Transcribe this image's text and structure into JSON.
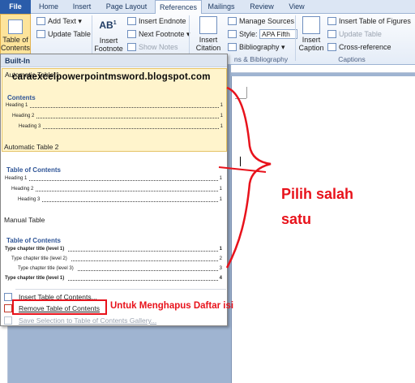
{
  "tabs": [
    "File",
    "Home",
    "Insert",
    "Page Layout",
    "References",
    "Mailings",
    "Review",
    "View"
  ],
  "active_tab": "References",
  "ribbon": {
    "toc_button": "Table of Contents",
    "add_text": "Add Text",
    "update_table": "Update Table",
    "insert_footnote": "Insert Footnote",
    "insert_endnote": "Insert Endnote",
    "next_footnote": "Next Footnote",
    "show_notes": "Show Notes",
    "insert_citation": "Insert Citation",
    "manage_sources": "Manage Sources",
    "style_label": "Style:",
    "style_value": "APA Fifth",
    "bibliography": "Bibliography",
    "group_citations": "ns & Bibliography",
    "insert_caption": "Insert Caption",
    "insert_table_of_figures": "Insert Table of Figures",
    "update_table_captions": "Update Table",
    "cross_reference": "Cross-reference",
    "group_captions": "Captions"
  },
  "menu": {
    "header": "Built-In",
    "items": [
      {
        "title": "Automatic Table 1",
        "heading": "Contents",
        "lines": [
          {
            "label": "Heading 1",
            "num": "1"
          },
          {
            "label": "Heading 2",
            "num": "1"
          },
          {
            "label": "Heading 3",
            "num": "1"
          }
        ]
      },
      {
        "title": "Automatic Table 2",
        "heading": "Table of Contents",
        "lines": [
          {
            "label": "Heading 1",
            "num": "1"
          },
          {
            "label": "Heading 2",
            "num": "1"
          },
          {
            "label": "Heading 3",
            "num": "1"
          }
        ]
      },
      {
        "title": "Manual Table",
        "heading": "Table of Contents",
        "lines": [
          {
            "label": "Type chapter title (level 1)",
            "num": "1"
          },
          {
            "label": "Type chapter title (level 2)",
            "num": "2"
          },
          {
            "label": "Type chapter title (level 3)",
            "num": "3"
          },
          {
            "label": "Type chapter title (level 1)",
            "num": "4"
          }
        ]
      }
    ],
    "insert_toc": "Insert Table of Contents...",
    "remove_toc": "Remove Table of Contents",
    "save_selection": "Save Selection to Table of Contents Gallery..."
  },
  "watermark": "caraexcelpowerpointmsword.blogspot.com",
  "annotations": {
    "choose": "Pilih salah satu",
    "remove": "Untuk Menghapus Daftar isi"
  },
  "colors": {
    "annotation": "#e8121b",
    "file_tab": "#2a5caa",
    "toc_heading": "#2f5597"
  }
}
